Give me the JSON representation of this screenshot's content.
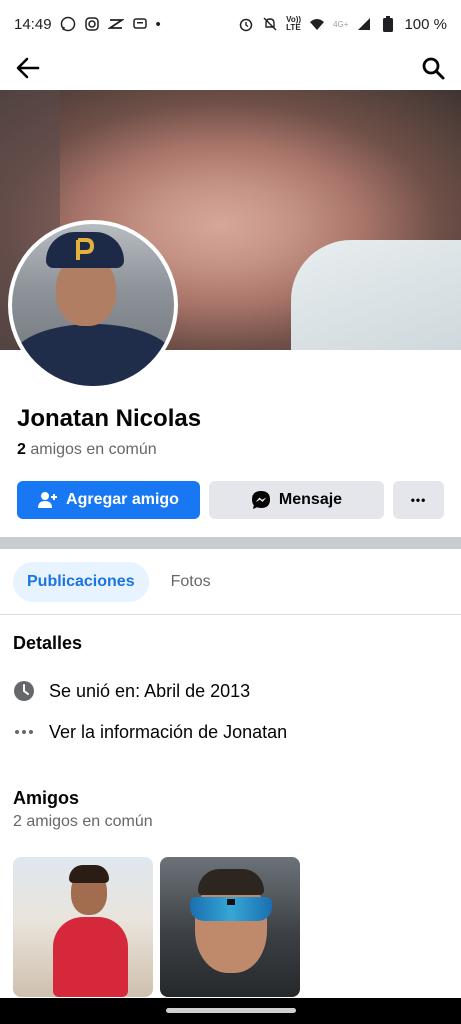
{
  "status_bar": {
    "time": "14:49",
    "dot": "•",
    "network_label": "4G+",
    "lte_top": "Vo))",
    "lte_bottom": "LTE",
    "battery": "100 %"
  },
  "profile": {
    "name": "Jonatan Nicolas",
    "mutual_count": "2",
    "mutual_text": " amigos en común"
  },
  "actions": {
    "add_friend": "Agregar amigo",
    "message": "Mensaje",
    "more": "•••"
  },
  "tabs": [
    {
      "label": "Publicaciones",
      "active": true
    },
    {
      "label": "Fotos",
      "active": false
    }
  ],
  "details": {
    "title": "Detalles",
    "joined": "Se unió en: Abril de 2013",
    "see_info": "Ver la información de Jonatan"
  },
  "friends": {
    "title": "Amigos",
    "subtitle": "2 amigos en común"
  },
  "colors": {
    "primary": "#1877f2",
    "tab_active_bg": "#e7f3ff",
    "secondary_button": "#e4e6eb"
  }
}
